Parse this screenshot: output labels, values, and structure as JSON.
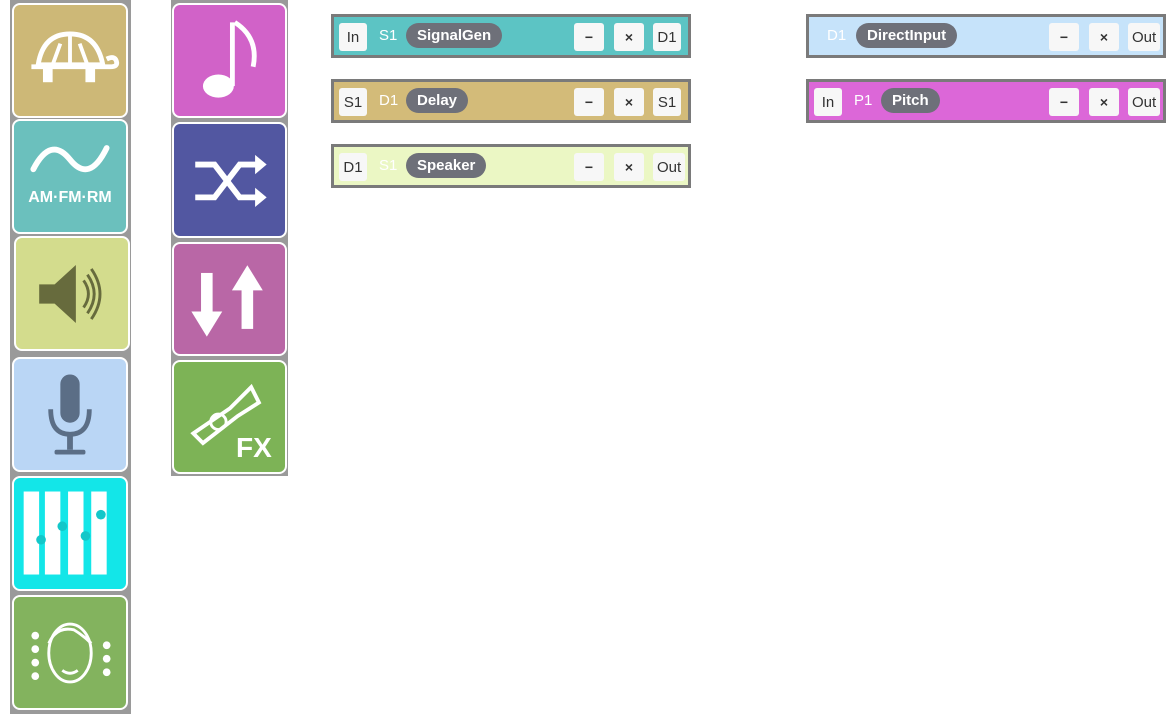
{
  "palette": {
    "col1": [
      {
        "name": "turtle-tile",
        "icon": "turtle-icon",
        "color": "#cdb877"
      },
      {
        "name": "am-fm-rm-tile",
        "icon": "sine-wave-icon",
        "label": "AM·FM·RM",
        "color": "#6bc0bd"
      },
      {
        "name": "speaker-tile",
        "icon": "speaker-icon",
        "color": "#d3dc8d"
      },
      {
        "name": "microphone-tile",
        "icon": "microphone-icon",
        "color": "#bad6f5"
      },
      {
        "name": "mixer-tile",
        "icon": "sliders-icon",
        "color": "#13e6e8"
      },
      {
        "name": "face-tile",
        "icon": "face-icon",
        "color": "#83b35e"
      }
    ],
    "col2": [
      {
        "name": "music-note-tile",
        "icon": "music-note-icon",
        "color": "#d162c8"
      },
      {
        "name": "shuffle-tile",
        "icon": "shuffle-icon",
        "color": "#5257a1"
      },
      {
        "name": "up-down-tile",
        "icon": "up-down-arrows-icon",
        "color": "#b967a6"
      },
      {
        "name": "trumpet-fx-tile",
        "icon": "trumpet-icon",
        "label": "FX",
        "color": "#7db356"
      }
    ]
  },
  "nodes": [
    {
      "id": "signalgen",
      "bg": "#5cc4c4",
      "tag_color": "#ffffff",
      "in": "In",
      "tag": "S1",
      "name": "SignalGen",
      "minus": "−",
      "close": "×",
      "out": "D1"
    },
    {
      "id": "delay",
      "bg": "#d3bb79",
      "tag_color": "#ffffff",
      "in": "S1",
      "tag": "D1",
      "name": "Delay",
      "minus": "−",
      "close": "×",
      "out": "S1"
    },
    {
      "id": "speaker",
      "bg": "#ebf7c4",
      "tag_color": "#ffffff",
      "in": "D1",
      "tag": "S1",
      "name": "Speaker",
      "minus": "−",
      "close": "×",
      "out": "Out"
    },
    {
      "id": "directinput",
      "bg": "#c6e3fa",
      "tag_color": "#ffffff",
      "in": "",
      "tag": "D1",
      "name": "DirectInput",
      "minus": "−",
      "close": "×",
      "out": "Out"
    },
    {
      "id": "pitch",
      "bg": "#dc67d8",
      "tag_color": "#ffffff",
      "in": "In",
      "tag": "P1",
      "name": "Pitch",
      "minus": "−",
      "close": "×",
      "out": "Out"
    }
  ]
}
